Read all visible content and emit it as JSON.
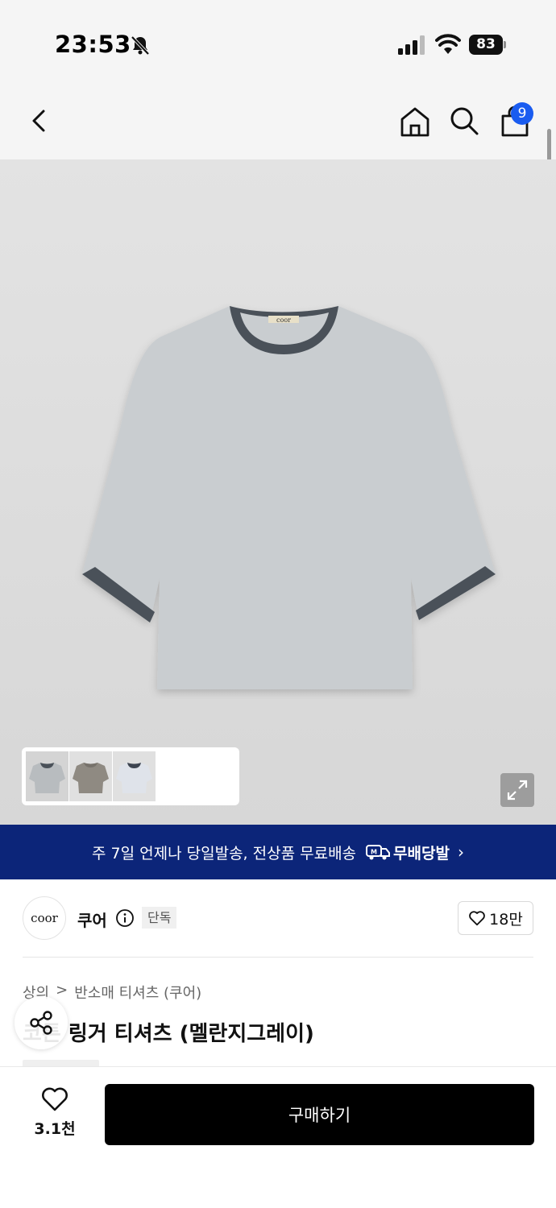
{
  "status_bar": {
    "time": "23:53",
    "battery": "83"
  },
  "nav": {
    "cart_count": "9"
  },
  "gallery": {
    "label_text": "coor",
    "thumbnail_count": 3
  },
  "promo": {
    "text": "주 7일 언제나 당일발송, 전상품 무료배송",
    "brand": "무배당발",
    "chevron": "›"
  },
  "brand": {
    "logo_text": "coor",
    "name": "쿠어",
    "badge": "단독",
    "likes": "18만"
  },
  "breadcrumb": {
    "category": "상의",
    "separator": ">",
    "subcategory": "반소매 티셔츠 (쿠어)"
  },
  "product": {
    "title": "코튼 링거 티셔츠 (멜란지그레이)"
  },
  "bottom_bar": {
    "wish_count": "3.1천",
    "buy_label": "구매하기"
  },
  "colors": {
    "promo_bg": "#0c2579",
    "badge_blue": "#1a5cf0",
    "shirt_body": "#c9cdd0",
    "shirt_trim": "#4a5159"
  }
}
